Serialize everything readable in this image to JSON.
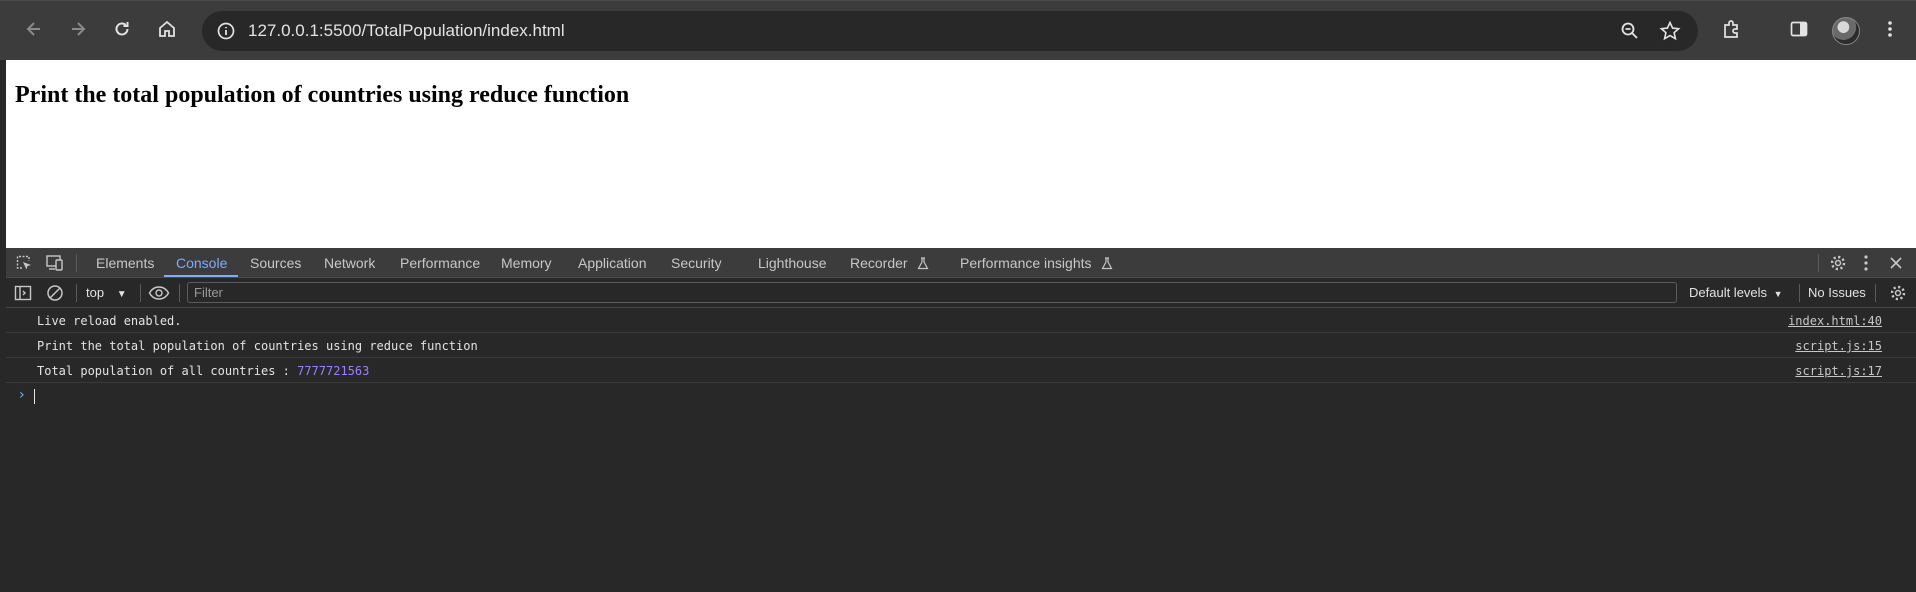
{
  "browser": {
    "url": "127.0.0.1:5500/TotalPopulation/index.html",
    "icons": [
      "back-icon",
      "forward-icon",
      "reload-icon",
      "home-icon",
      "site-info-icon",
      "zoom-icon",
      "bookmark-star-icon",
      "extensions-icon",
      "side-panel-icon",
      "profile-avatar",
      "menu-icon"
    ]
  },
  "page": {
    "heading": "Print the total population of countries using reduce function"
  },
  "devtools": {
    "tabs": [
      {
        "label": "Elements"
      },
      {
        "label": "Console",
        "active": true
      },
      {
        "label": "Sources"
      },
      {
        "label": "Network"
      },
      {
        "label": "Performance"
      },
      {
        "label": "Memory"
      },
      {
        "label": "Application"
      },
      {
        "label": "Security"
      },
      {
        "label": "Lighthouse"
      },
      {
        "label": "Recorder"
      },
      {
        "label": "Performance insights"
      }
    ],
    "toolbar": {
      "context": "top",
      "filter_placeholder": "Filter",
      "levels": "Default levels",
      "issues": "No Issues"
    },
    "console": [
      {
        "text": "Live reload enabled.",
        "source": "index.html:40"
      },
      {
        "text": "Print the total population of countries using reduce function",
        "source": "script.js:15"
      },
      {
        "text": "Total population of all countries : ",
        "value": "7777721563",
        "source": "script.js:17"
      }
    ]
  },
  "colors": {
    "accent": "#7cacf8",
    "number": "#9980ff",
    "chrome": "#3c3c3c",
    "panel": "#282828"
  }
}
